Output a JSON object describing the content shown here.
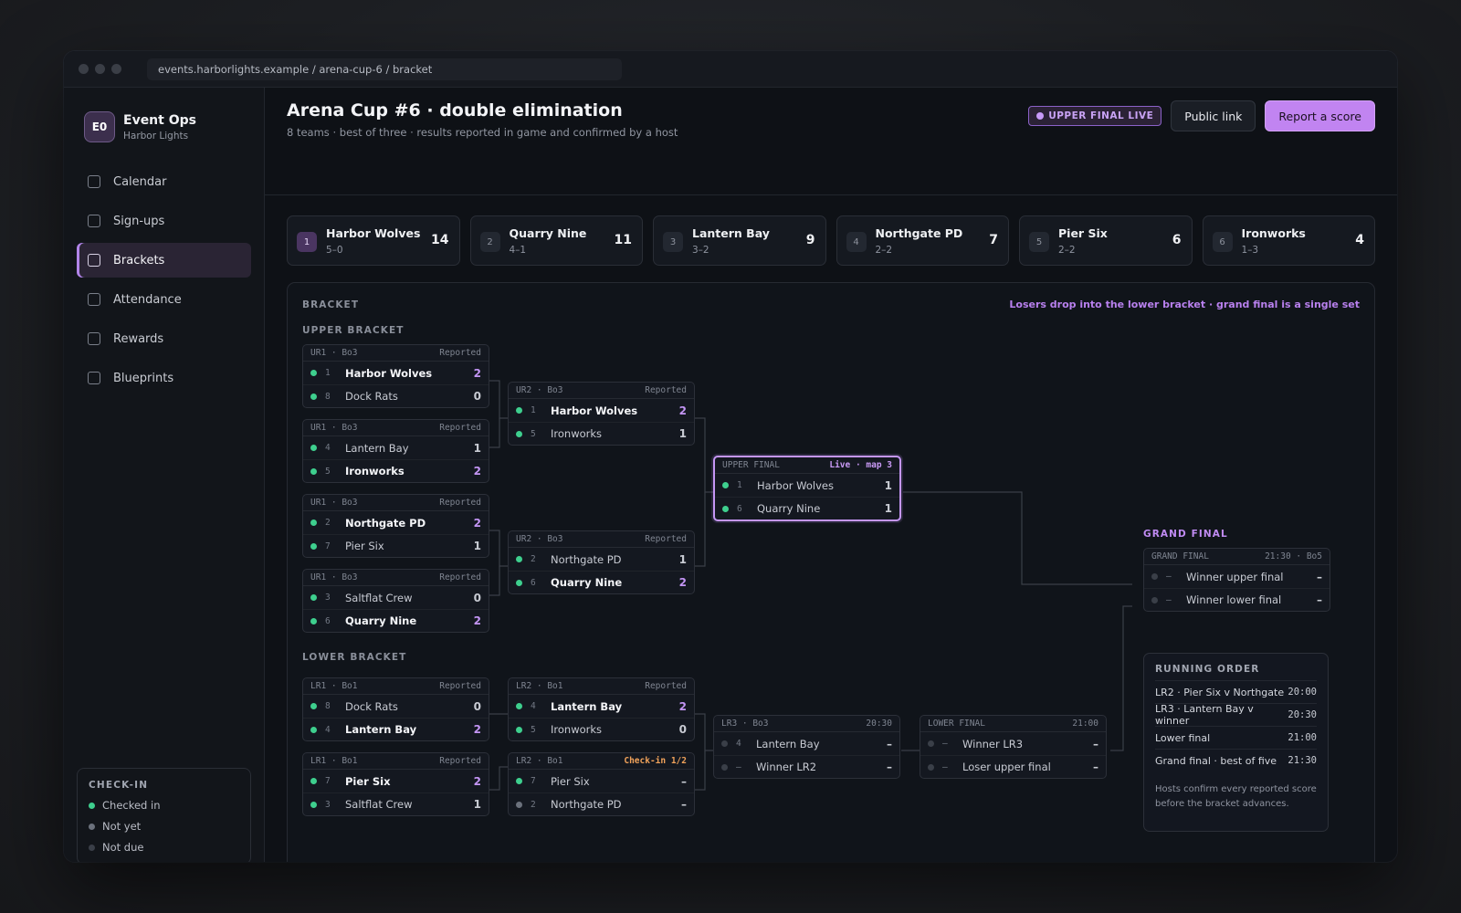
{
  "browser": {
    "url": "events.harborlights.example / arena-cup-6 / bracket"
  },
  "sidebar": {
    "brand": {
      "initials": "E0",
      "name": "Event Ops",
      "subtitle": "Harbor Lights"
    },
    "items": [
      {
        "label": "Calendar",
        "active": false
      },
      {
        "label": "Sign-ups",
        "active": false
      },
      {
        "label": "Brackets",
        "active": true
      },
      {
        "label": "Attendance",
        "active": false
      },
      {
        "label": "Rewards",
        "active": false
      },
      {
        "label": "Blueprints",
        "active": false
      }
    ],
    "checkin": {
      "title": "CHECK-IN",
      "legend": [
        {
          "label": "Checked in",
          "color": "#3ecf8e"
        },
        {
          "label": "Not yet",
          "color": "#6b717c"
        },
        {
          "label": "Not due",
          "color": "#3a3f48"
        }
      ]
    }
  },
  "header": {
    "title": "Arena Cup #6 · double elimination",
    "subtitle": "8 teams · best of three · results reported in game and confirmed by a host",
    "live_badge": "UPPER FINAL LIVE",
    "public_link": "Public link",
    "report_score": "Report a score"
  },
  "standings": [
    {
      "seed": "1",
      "name": "Harbor Wolves",
      "record": "5–0",
      "points": "14"
    },
    {
      "seed": "2",
      "name": "Quarry Nine",
      "record": "4–1",
      "points": "11"
    },
    {
      "seed": "3",
      "name": "Lantern Bay",
      "record": "3–2",
      "points": "9"
    },
    {
      "seed": "4",
      "name": "Northgate PD",
      "record": "2–2",
      "points": "7"
    },
    {
      "seed": "5",
      "name": "Pier Six",
      "record": "2–2",
      "points": "6"
    },
    {
      "seed": "6",
      "name": "Ironworks",
      "record": "1–3",
      "points": "4"
    }
  ],
  "bracket": {
    "title": "BRACKET",
    "note": "Losers drop into the lower bracket · grand final is a single set",
    "upper_label": "UPPER BRACKET",
    "lower_label": "LOWER BRACKET",
    "grand_final_label": "GRAND FINAL",
    "matches": [
      {
        "id": "ur1a",
        "round": "UR1 · Bo3",
        "status": "Reported",
        "teams": [
          {
            "seed": "1",
            "name": "Harbor Wolves",
            "score": "2",
            "win": true,
            "dot": "#3ecf8e"
          },
          {
            "seed": "8",
            "name": "Dock Rats",
            "score": "0",
            "win": false,
            "dot": "#3ecf8e"
          }
        ]
      },
      {
        "id": "ur1b",
        "round": "UR1 · Bo3",
        "status": "Reported",
        "teams": [
          {
            "seed": "4",
            "name": "Lantern Bay",
            "score": "1",
            "win": false,
            "dot": "#3ecf8e"
          },
          {
            "seed": "5",
            "name": "Ironworks",
            "score": "2",
            "win": true,
            "dot": "#3ecf8e"
          }
        ]
      },
      {
        "id": "ur1c",
        "round": "UR1 · Bo3",
        "status": "Reported",
        "teams": [
          {
            "seed": "2",
            "name": "Northgate PD",
            "score": "2",
            "win": true,
            "dot": "#3ecf8e"
          },
          {
            "seed": "7",
            "name": "Pier Six",
            "score": "1",
            "win": false,
            "dot": "#3ecf8e"
          }
        ]
      },
      {
        "id": "ur1d",
        "round": "UR1 · Bo3",
        "status": "Reported",
        "teams": [
          {
            "seed": "3",
            "name": "Saltflat Crew",
            "score": "0",
            "win": false,
            "dot": "#3ecf8e"
          },
          {
            "seed": "6",
            "name": "Quarry Nine",
            "score": "2",
            "win": true,
            "dot": "#3ecf8e"
          }
        ]
      },
      {
        "id": "ur2a",
        "round": "UR2 · Bo3",
        "status": "Reported",
        "teams": [
          {
            "seed": "1",
            "name": "Harbor Wolves",
            "score": "2",
            "win": true,
            "dot": "#3ecf8e"
          },
          {
            "seed": "5",
            "name": "Ironworks",
            "score": "1",
            "win": false,
            "dot": "#3ecf8e"
          }
        ]
      },
      {
        "id": "ur2b",
        "round": "UR2 · Bo3",
        "status": "Reported",
        "teams": [
          {
            "seed": "2",
            "name": "Northgate PD",
            "score": "1",
            "win": false,
            "dot": "#3ecf8e"
          },
          {
            "seed": "6",
            "name": "Quarry Nine",
            "score": "2",
            "win": true,
            "dot": "#3ecf8e"
          }
        ]
      },
      {
        "id": "uf",
        "round": "UPPER FINAL",
        "status": "Live · map 3",
        "status_type": "live",
        "live": true,
        "teams": [
          {
            "seed": "1",
            "name": "Harbor Wolves",
            "score": "1",
            "win": false,
            "dot": "#3ecf8e"
          },
          {
            "seed": "6",
            "name": "Quarry Nine",
            "score": "1",
            "win": false,
            "dot": "#3ecf8e"
          }
        ]
      },
      {
        "id": "gf",
        "round": "GRAND FINAL",
        "status": "21:30 · Bo5",
        "teams": [
          {
            "seed": "–",
            "name": "Winner upper final",
            "score": "–",
            "win": false,
            "dot": "#3a3f48"
          },
          {
            "seed": "–",
            "name": "Winner lower final",
            "score": "–",
            "win": false,
            "dot": "#3a3f48"
          }
        ]
      },
      {
        "id": "lr1a",
        "round": "LR1 · Bo1",
        "status": "Reported",
        "teams": [
          {
            "seed": "8",
            "name": "Dock Rats",
            "score": "0",
            "win": false,
            "dot": "#3ecf8e"
          },
          {
            "seed": "4",
            "name": "Lantern Bay",
            "score": "2",
            "win": true,
            "dot": "#3ecf8e"
          }
        ]
      },
      {
        "id": "lr1b",
        "round": "LR1 · Bo1",
        "status": "Reported",
        "teams": [
          {
            "seed": "7",
            "name": "Pier Six",
            "score": "2",
            "win": true,
            "dot": "#3ecf8e"
          },
          {
            "seed": "3",
            "name": "Saltflat Crew",
            "score": "1",
            "win": false,
            "dot": "#3ecf8e"
          }
        ]
      },
      {
        "id": "lr2a",
        "round": "LR2 · Bo1",
        "status": "Reported",
        "teams": [
          {
            "seed": "4",
            "name": "Lantern Bay",
            "score": "2",
            "win": true,
            "dot": "#3ecf8e"
          },
          {
            "seed": "5",
            "name": "Ironworks",
            "score": "0",
            "win": false,
            "dot": "#3ecf8e"
          }
        ]
      },
      {
        "id": "lr2b",
        "round": "LR2 · Bo1",
        "status": "Check-in 1/2",
        "status_type": "warn",
        "teams": [
          {
            "seed": "7",
            "name": "Pier Six",
            "score": "–",
            "win": false,
            "dot": "#3ecf8e"
          },
          {
            "seed": "2",
            "name": "Northgate PD",
            "score": "–",
            "win": false,
            "dot": "#6b717c"
          }
        ]
      },
      {
        "id": "lr3",
        "round": "LR3 · Bo3",
        "status": "20:30",
        "teams": [
          {
            "seed": "4",
            "name": "Lantern Bay",
            "score": "–",
            "win": false,
            "dot": "#3a3f48"
          },
          {
            "seed": "–",
            "name": "Winner LR2",
            "score": "–",
            "win": false,
            "dot": "#3a3f48"
          }
        ]
      },
      {
        "id": "lf",
        "round": "LOWER FINAL",
        "status": "21:00",
        "teams": [
          {
            "seed": "–",
            "name": "Winner LR3",
            "score": "–",
            "win": false,
            "dot": "#3a3f48"
          },
          {
            "seed": "–",
            "name": "Loser upper final",
            "score": "–",
            "win": false,
            "dot": "#3a3f48"
          }
        ]
      }
    ]
  },
  "running_order": {
    "title": "RUNNING ORDER",
    "rows": [
      {
        "label": "LR2 · Pier Six v Northgate",
        "time": "20:00"
      },
      {
        "label": "LR3 · Lantern Bay v winner",
        "time": "20:30"
      },
      {
        "label": "Lower final",
        "time": "21:00"
      },
      {
        "label": "Grand final · best of five",
        "time": "21:30"
      }
    ],
    "note": "Hosts confirm every reported score before the bracket advances."
  }
}
